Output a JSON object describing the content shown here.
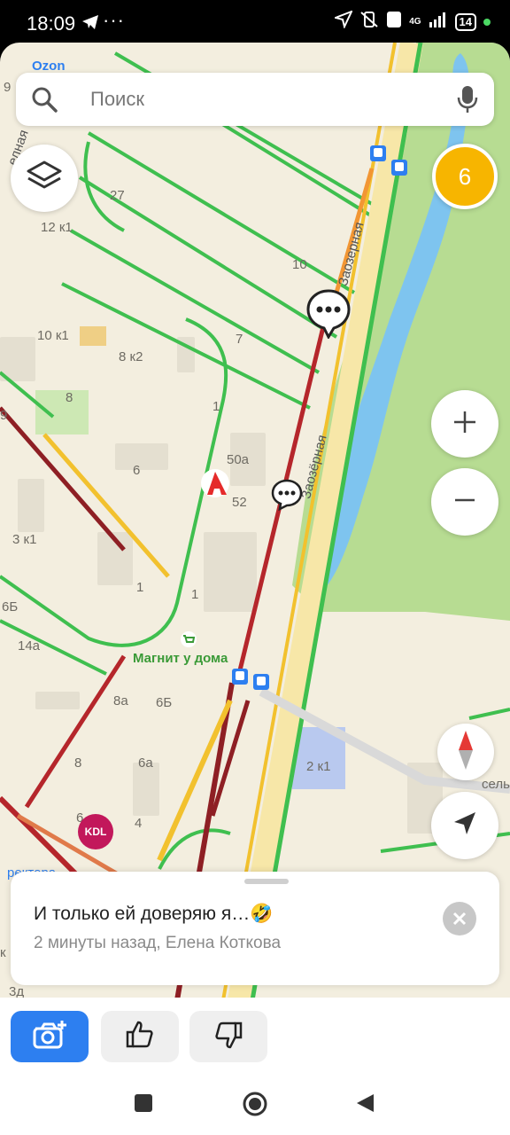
{
  "status": {
    "time": "18:09",
    "dots": "···",
    "net_tag": "4G",
    "battery": "14"
  },
  "search": {
    "placeholder": "Поиск"
  },
  "traffic_badge": "6",
  "map": {
    "poi_top": "Ozon",
    "poi_magnit": "Магнит у дома",
    "poi_kdl": "KDL",
    "street_zaozernaya": "Заозёрная",
    "street_zaozernaya_top": "Заозерная",
    "street_rektora": "ректора",
    "street_left": "елная",
    "right_edge": "сель",
    "labels": [
      "9",
      "27",
      "12 к1",
      "10",
      "10 к1",
      "7",
      "8 к2",
      "8",
      "1",
      "50а",
      "6",
      "52",
      "9",
      "3 к1",
      "1",
      "1",
      "6Б",
      "14а",
      "8а",
      "6Б",
      "8",
      "6а",
      "2 к1",
      "6",
      "4",
      "3д",
      "к"
    ]
  },
  "card": {
    "title": "И только ей доверяю я…🤣",
    "subtitle": "2 минуты назад, Елена Коткова"
  },
  "colors": {
    "accent_blue": "#2d7ff0",
    "badge_orange": "#f7b500",
    "traffic_red": "#b5262b",
    "traffic_green": "#3fbf4f",
    "traffic_yellow": "#f2c12e"
  }
}
